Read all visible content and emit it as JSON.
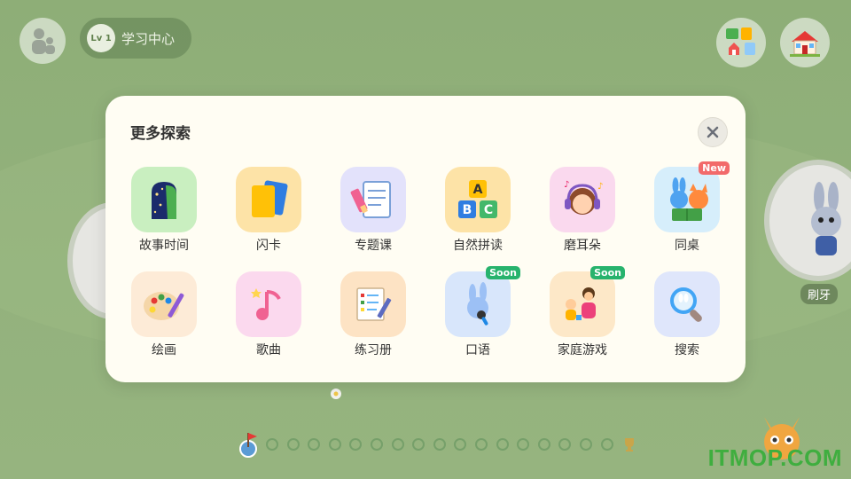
{
  "header": {
    "level_badge": "Lv 1",
    "learning_center_label": "学习中心"
  },
  "modal": {
    "title": "更多探索",
    "items": [
      {
        "label": "故事时间",
        "icon": "story-door-icon"
      },
      {
        "label": "闪卡",
        "icon": "flashcards-icon"
      },
      {
        "label": "专题课",
        "icon": "notebook-icon"
      },
      {
        "label": "自然拼读",
        "icon": "abc-blocks-icon"
      },
      {
        "label": "磨耳朵",
        "icon": "headphones-girl-icon"
      },
      {
        "label": "同桌",
        "icon": "deskmate-friends-icon",
        "badge": "New"
      },
      {
        "label": "绘画",
        "icon": "palette-icon"
      },
      {
        "label": "歌曲",
        "icon": "music-note-icon"
      },
      {
        "label": "练习册",
        "icon": "workbook-icon"
      },
      {
        "label": "口语",
        "icon": "microphone-bunny-icon",
        "badge": "Soon"
      },
      {
        "label": "家庭游戏",
        "icon": "family-play-icon",
        "badge": "Soon"
      },
      {
        "label": "搜索",
        "icon": "magnifier-icon"
      }
    ]
  },
  "side_stage_label": "刷牙",
  "progress_dots_count": 17,
  "watermark": "ITMOP.COM",
  "colors": {
    "modal_bg": "#fffdf3",
    "new_badge": "#f26a6a",
    "soon_badge": "#27b36d",
    "background": "#8fb07a"
  }
}
